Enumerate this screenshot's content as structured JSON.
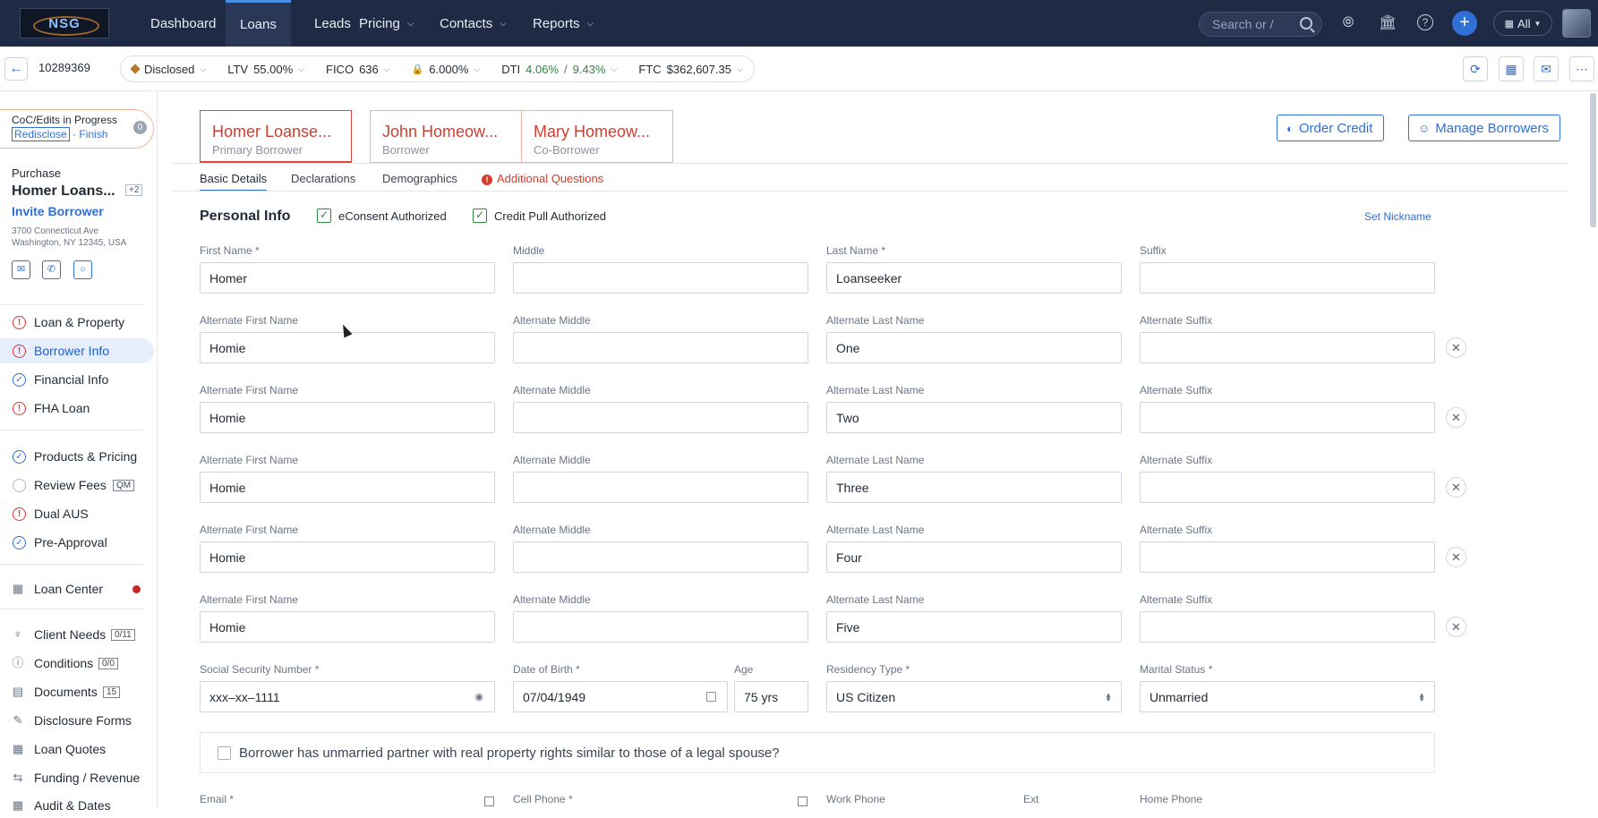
{
  "nav": {
    "logo": "NSG",
    "items": [
      {
        "label": "Dashboard",
        "dropdown": false
      },
      {
        "label": "Loans",
        "dropdown": false
      },
      {
        "label": "Leads",
        "dropdown": false
      },
      {
        "label": "Pricing",
        "dropdown": true
      },
      {
        "label": "Contacts",
        "dropdown": true
      },
      {
        "label": "Reports",
        "dropdown": true
      }
    ],
    "active": "Loans",
    "search_placeholder": "Search or /",
    "all_label": "All"
  },
  "subbar": {
    "loan_number": "10289369",
    "status": "Disclosed",
    "ltv_label": "LTV",
    "ltv_value": "55.00%",
    "fico_label": "FICO",
    "fico_value": "636",
    "rate": "6.000%",
    "dti_label": "DTI",
    "dti_front": "4.06%",
    "dti_sep": "/",
    "dti_back": "9.43%",
    "ftc_label": "FTC",
    "ftc_value": "$362,607.35"
  },
  "sidebar": {
    "coc_title": "CoC/Edits in Progress",
    "coc_redisclose": "Redisclose",
    "coc_sep": "·",
    "coc_finish": "Finish",
    "coc_count": "0",
    "purpose": "Purchase",
    "borrower_name": "Homer Loans...",
    "extra_count": "+2",
    "invite": "Invite Borrower",
    "address_line1": "3700 Connecticut Ave",
    "address_line2": "Washington, NY 12345, USA",
    "section1": [
      {
        "label": "Loan & Property",
        "status": "warn"
      },
      {
        "label": "Borrower Info",
        "status": "warn",
        "active": true
      },
      {
        "label": "Financial Info",
        "status": "ok"
      },
      {
        "label": "FHA Loan",
        "status": "warn"
      }
    ],
    "section2": [
      {
        "label": "Products & Pricing",
        "status": "ok"
      },
      {
        "label": "Review Fees",
        "status": "empty",
        "badge": "QM"
      },
      {
        "label": "Dual AUS",
        "status": "warn"
      },
      {
        "label": "Pre-Approval",
        "status": "ok"
      }
    ],
    "loan_center": "Loan Center",
    "section3": [
      {
        "label": "Client Needs",
        "badge": "0/11"
      },
      {
        "label": "Conditions",
        "badge": "0/0"
      },
      {
        "label": "Documents",
        "badge": "15"
      },
      {
        "label": "Disclosure Forms"
      },
      {
        "label": "Loan Quotes"
      },
      {
        "label": "Funding / Revenue"
      },
      {
        "label": "Audit & Dates"
      }
    ]
  },
  "borrower_tabs": [
    {
      "name": "Homer Loanse...",
      "role": "Primary Borrower"
    },
    {
      "name": "John Homeow...",
      "role": "Borrower"
    },
    {
      "name": "Mary Homeow...",
      "role": "Co-Borrower"
    }
  ],
  "actions": {
    "order_credit": "Order Credit",
    "manage_borrowers": "Manage Borrowers"
  },
  "section_tabs": [
    "Basic Details",
    "Declarations",
    "Demographics",
    "Additional Questions"
  ],
  "personal_info": {
    "title": "Personal Info",
    "econsent": "eConsent Authorized",
    "credit_pull": "Credit Pull Authorized",
    "set_nickname": "Set Nickname",
    "labels": {
      "first": "First Name *",
      "middle": "Middle",
      "last": "Last Name *",
      "suffix": "Suffix",
      "alt_first": "Alternate First Name",
      "alt_middle": "Alternate Middle",
      "alt_last": "Alternate Last Name",
      "alt_suffix": "Alternate Suffix",
      "ssn": "Social Security Number *",
      "dob": "Date of Birth *",
      "age": "Age",
      "residency": "Residency Type *",
      "marital": "Marital Status *",
      "email": "Email *",
      "cell": "Cell Phone *",
      "work": "Work Phone",
      "ext": "Ext",
      "home": "Home Phone"
    },
    "first_name": "Homer",
    "middle": "",
    "last_name": "Loanseeker",
    "suffix": "",
    "alternates": [
      {
        "first": "Homie",
        "middle": "",
        "last": "One",
        "suffix": ""
      },
      {
        "first": "Homie",
        "middle": "",
        "last": "Two",
        "suffix": ""
      },
      {
        "first": "Homie",
        "middle": "",
        "last": "Three",
        "suffix": ""
      },
      {
        "first": "Homie",
        "middle": "",
        "last": "Four",
        "suffix": ""
      },
      {
        "first": "Homie",
        "middle": "",
        "last": "Five",
        "suffix": ""
      }
    ],
    "ssn": "xxx–xx–1111",
    "dob": "07/04/1949",
    "age": "75 yrs",
    "residency": "US Citizen",
    "marital": "Unmarried",
    "partner_question": "Borrower has unmarried partner with real property rights similar to those of a legal spouse?"
  }
}
